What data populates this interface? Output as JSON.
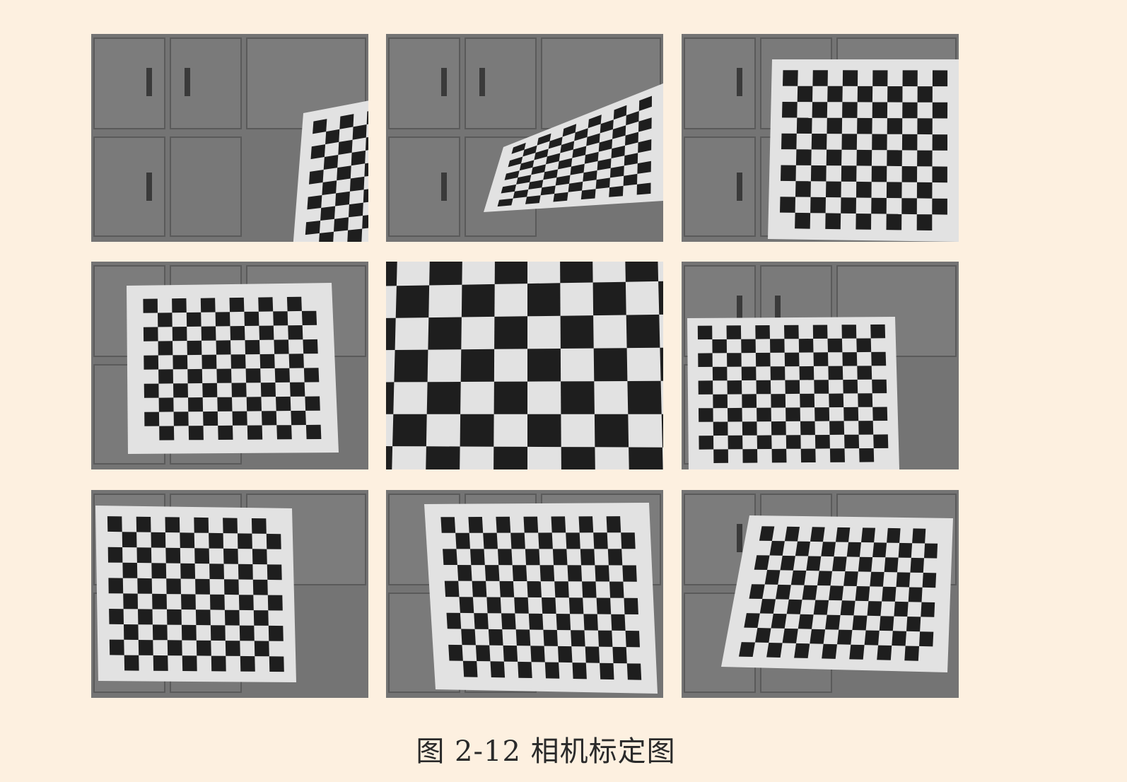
{
  "figure": {
    "caption": "图 2-12 相机标定图",
    "images": [
      {
        "name": "calibration-photo-1",
        "board": {
          "rows": 10,
          "cols": 10
        }
      },
      {
        "name": "calibration-photo-2",
        "board": {
          "rows": 9,
          "cols": 11
        }
      },
      {
        "name": "calibration-photo-3",
        "board": {
          "rows": 10,
          "cols": 11
        }
      },
      {
        "name": "calibration-photo-4",
        "board": {
          "rows": 10,
          "cols": 12
        }
      },
      {
        "name": "calibration-photo-5",
        "board": {
          "rows": 7,
          "cols": 10
        }
      },
      {
        "name": "calibration-photo-6",
        "board": {
          "rows": 10,
          "cols": 13
        }
      },
      {
        "name": "calibration-photo-7",
        "board": {
          "rows": 10,
          "cols": 12
        }
      },
      {
        "name": "calibration-photo-8",
        "board": {
          "rows": 10,
          "cols": 14
        }
      },
      {
        "name": "calibration-photo-9",
        "board": {
          "rows": 9,
          "cols": 14
        }
      }
    ]
  },
  "colors": {
    "page_background": "#fdf0e0",
    "photo_background": "#6e6e6e",
    "board_white": "#e2e2e2",
    "board_black": "#1e1e1e"
  }
}
